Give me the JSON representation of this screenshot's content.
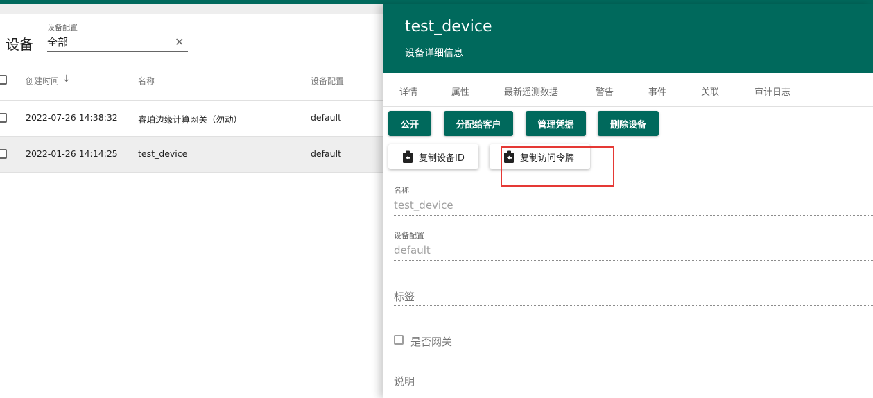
{
  "list": {
    "title": "设备",
    "filter": {
      "label": "设备配置",
      "value": "全部"
    },
    "columns": [
      "创建时间",
      "名称",
      "设备配置"
    ],
    "rows": [
      {
        "created": "2022-07-26 14:38:32",
        "name": "睿珀边缘计算网关（勿动）",
        "profile": "default"
      },
      {
        "created": "2022-01-26 14:14:25",
        "name": "test_device",
        "profile": "default"
      }
    ]
  },
  "detail": {
    "name": "test_device",
    "subtitle": "设备详细信息",
    "tabs": [
      "详情",
      "属性",
      "最新遥测数据",
      "警告",
      "事件",
      "关联",
      "审计日志"
    ],
    "actions": [
      "公开",
      "分配给客户",
      "管理凭据",
      "删除设备"
    ],
    "copy_actions": [
      "复制设备ID",
      "复制访问令牌"
    ],
    "fields": {
      "name_label": "名称",
      "name_value": "test_device",
      "profile_label": "设备配置",
      "profile_value": "default",
      "tags_label": "标签",
      "gateway_label": "是否网关",
      "description_label": "说明"
    }
  },
  "colors": {
    "primary": "#00695c",
    "highlight": "#e53935"
  }
}
